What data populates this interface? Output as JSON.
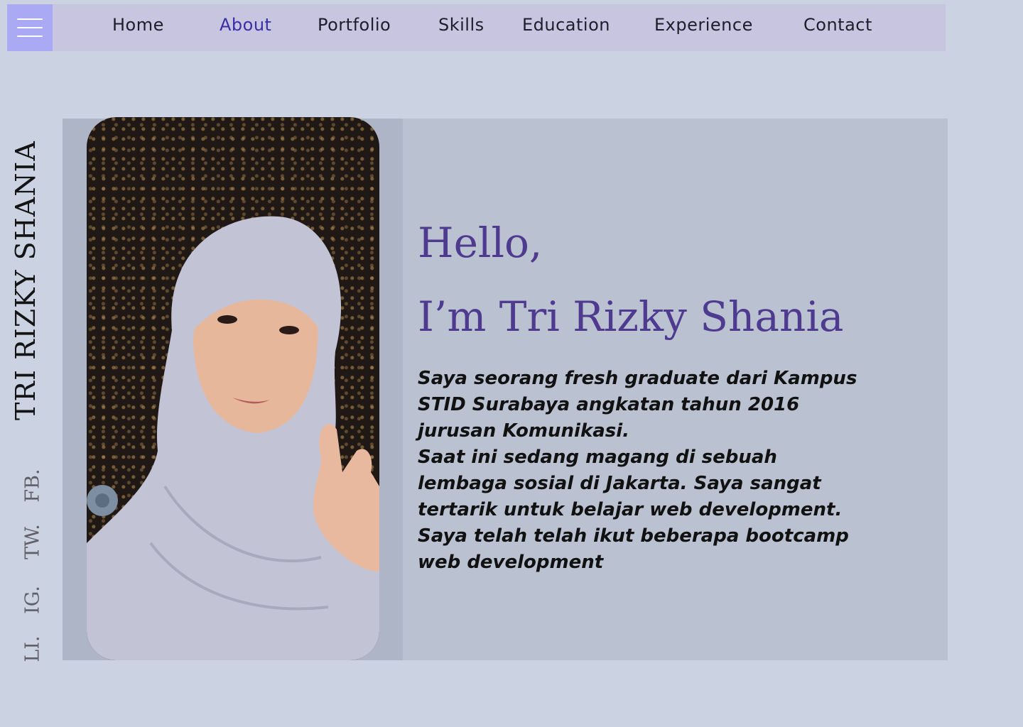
{
  "nav": {
    "items": [
      {
        "label": "Home",
        "active": false
      },
      {
        "label": "About",
        "active": true
      },
      {
        "label": "Portfolio",
        "active": false
      },
      {
        "label": "Skills",
        "active": false
      },
      {
        "label": "Education",
        "active": false
      },
      {
        "label": "Experience",
        "active": false
      },
      {
        "label": "Contact",
        "active": false
      }
    ],
    "menu_icon": "hamburger-icon"
  },
  "side": {
    "name": "TRI RIZKY SHANIA",
    "social": [
      "FB.",
      "TW.",
      "IG.",
      "LI."
    ]
  },
  "hero": {
    "greeting_line1": "Hello,",
    "greeting_line2": "I’m Tri Rizky Shania",
    "bio": [
      "Saya seorang fresh graduate dari Kampus STID Surabaya angkatan tahun 2016 jurusan Komunikasi.",
      "Saat ini sedang magang di sebuah lembaga sosial di Jakarta. Saya sangat tertarik untuk belajar web development.",
      "Saya telah telah ikut beberapa bootcamp web development"
    ]
  },
  "colors": {
    "background": "#cbd2e1",
    "nav_bg": "#c8c5e0",
    "menu_button": "#a9a9f4",
    "active_link": "#3a2ea8",
    "greeting": "#4e3a8e",
    "hero_bg": "#bac1d1",
    "photo_panel": "#aeb5c6"
  }
}
